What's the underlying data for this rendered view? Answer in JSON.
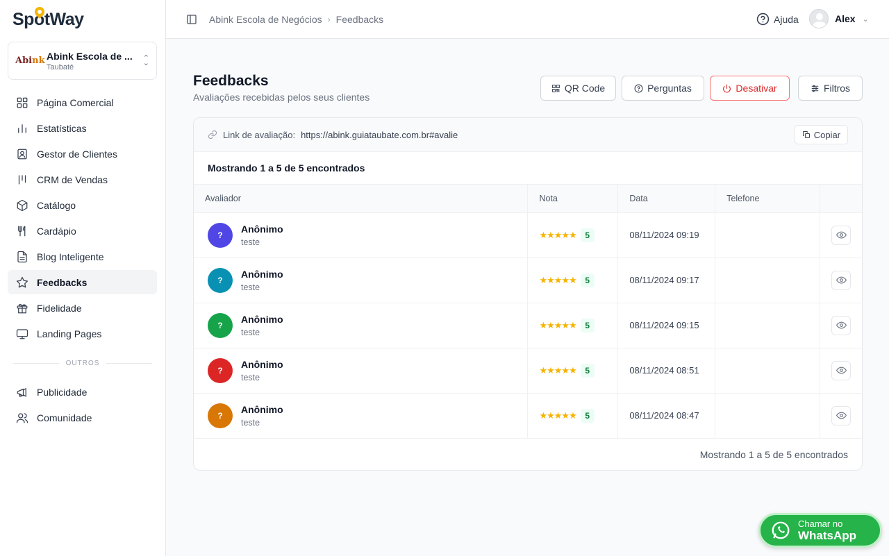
{
  "brand": {
    "logo_text": "SpotWay",
    "accent": "#f5b400"
  },
  "business": {
    "name": "Abink Escola de ...",
    "city": "Taubaté",
    "logo_text": "Abink"
  },
  "nav": {
    "items": [
      {
        "label": "Página Comercial",
        "icon": "grid-icon"
      },
      {
        "label": "Estatísticas",
        "icon": "bar-chart-icon"
      },
      {
        "label": "Gestor de Clientes",
        "icon": "contact-card-icon"
      },
      {
        "label": "CRM de Vendas",
        "icon": "kanban-icon"
      },
      {
        "label": "Catálogo",
        "icon": "box-icon"
      },
      {
        "label": "Cardápio",
        "icon": "utensils-icon"
      },
      {
        "label": "Blog Inteligente",
        "icon": "document-icon"
      },
      {
        "label": "Feedbacks",
        "icon": "star-icon",
        "active": true
      },
      {
        "label": "Fidelidade",
        "icon": "gift-icon"
      },
      {
        "label": "Landing Pages",
        "icon": "monitor-icon"
      }
    ],
    "section_label": "OUTROS",
    "other_items": [
      {
        "label": "Publicidade",
        "icon": "megaphone-icon"
      },
      {
        "label": "Comunidade",
        "icon": "users-icon"
      }
    ]
  },
  "header": {
    "breadcrumb": [
      "Abink Escola de Negócios",
      "Feedbacks"
    ],
    "help_label": "Ajuda",
    "user_name": "Alex"
  },
  "page": {
    "title": "Feedbacks",
    "subtitle": "Avaliações recebidas pelos seus clientes",
    "buttons": {
      "qrcode": "QR Code",
      "perguntas": "Perguntas",
      "desativar": "Desativar",
      "filtros": "Filtros"
    }
  },
  "link_bar": {
    "label": "Link de avaliação:",
    "url": "https://abink.guiataubate.com.br#avalie",
    "copy_label": "Copiar"
  },
  "results": {
    "top_text": "Mostrando 1 a 5 de 5 encontrados",
    "bottom_text": "Mostrando 1 a 5 de 5 encontrados"
  },
  "table": {
    "headers": [
      "Avaliador",
      "Nota",
      "Data",
      "Telefone",
      ""
    ],
    "rows": [
      {
        "initial": "?",
        "name": "Anônimo",
        "comment": "teste",
        "stars": "★★★★★",
        "score": "5",
        "date": "08/11/2024 09:19",
        "phone": "",
        "color": "#4f46e5"
      },
      {
        "initial": "?",
        "name": "Anônimo",
        "comment": "teste",
        "stars": "★★★★★",
        "score": "5",
        "date": "08/11/2024 09:17",
        "phone": "",
        "color": "#0891b2"
      },
      {
        "initial": "?",
        "name": "Anônimo",
        "comment": "teste",
        "stars": "★★★★★",
        "score": "5",
        "date": "08/11/2024 09:15",
        "phone": "",
        "color": "#16a34a"
      },
      {
        "initial": "?",
        "name": "Anônimo",
        "comment": "teste",
        "stars": "★★★★★",
        "score": "5",
        "date": "08/11/2024 08:51",
        "phone": "",
        "color": "#dc2626"
      },
      {
        "initial": "?",
        "name": "Anônimo",
        "comment": "teste",
        "stars": "★★★★★",
        "score": "5",
        "date": "08/11/2024 08:47",
        "phone": "",
        "color": "#d97706"
      }
    ]
  },
  "whatsapp": {
    "line1": "Chamar no",
    "line2": "WhatsApp",
    "color": "#26b34a"
  }
}
